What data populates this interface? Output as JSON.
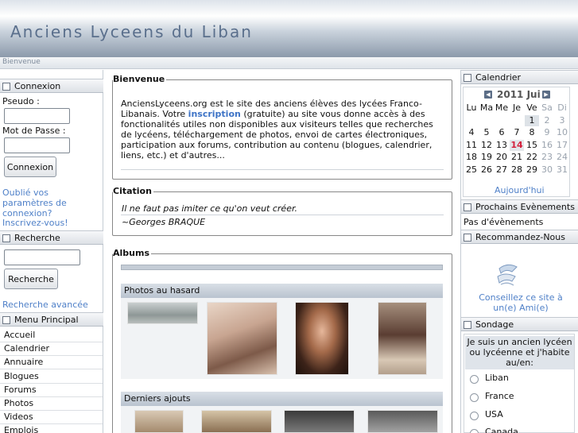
{
  "header": {
    "title": "Anciens Lyceens du Liban",
    "breadcrumb": "Bienvenue"
  },
  "login": {
    "heading": "Connexion",
    "username_label": "Pseudo :",
    "password_label": "Mot de Passe :",
    "submit_label": "Connexion",
    "forgot_link": "Oublié vos paramètres de connexion?",
    "register_link": "Inscrivez-vous!"
  },
  "search": {
    "heading": "Recherche",
    "submit_label": "Recherche",
    "advanced_link": "Recherche avancée"
  },
  "menu": {
    "heading": "Menu Principal",
    "items": [
      "Accueil",
      "Calendrier",
      "Annuaire",
      "Blogues",
      "Forums",
      "Photos",
      "Videos",
      "Emplois"
    ]
  },
  "welcome": {
    "legend": "Bienvenue",
    "text_before": "AnciensLyceens.org est le site des anciens élèves des lycées Franco-Libanais. Votre ",
    "link": "inscription",
    "text_after": " (gratuite) au site vous donne accès à des fonctionalités utiles non disponibles aux visiteurs telles que recherches de lycéens, téléchargement de photos, envoi de cartes électroniques, participation aux forums, contribution au contenu (blogues, calendrier, liens, etc.) et d'autres..."
  },
  "quote": {
    "legend": "Citation",
    "text": "Il ne faut pas imiter ce qu'on veut créer.",
    "author": "~Georges BRAQUE"
  },
  "albums": {
    "legend": "Albums",
    "random_heading": "Photos au hasard",
    "latest_heading": "Derniers ajouts"
  },
  "calendar": {
    "heading": "Calendrier",
    "month_label": "2011 Jui",
    "prev_icon": "prev-arrow-icon",
    "next_icon": "next-arrow-icon",
    "weekdays": [
      "Lu",
      "Ma",
      "Me",
      "Je",
      "Ve",
      "Sa",
      "Di"
    ],
    "weeks": [
      [
        "",
        "",
        "",
        "",
        "1",
        "2",
        "3"
      ],
      [
        "4",
        "5",
        "6",
        "7",
        "8",
        "9",
        "10"
      ],
      [
        "11",
        "12",
        "13",
        "14",
        "15",
        "16",
        "17"
      ],
      [
        "18",
        "19",
        "20",
        "21",
        "22",
        "23",
        "24"
      ],
      [
        "25",
        "26",
        "27",
        "28",
        "29",
        "30",
        "31"
      ]
    ],
    "today_link": "Aujourd'hui"
  },
  "events": {
    "heading": "Prochains Evènements",
    "empty_text": "Pas d'évènements"
  },
  "recommend": {
    "heading": "Recommandez-Nous",
    "link": "Conseillez ce site à un(e) Ami(e)"
  },
  "poll": {
    "heading": "Sondage",
    "question": "Je suis un ancien lycéen ou lycéenne et j'habite au/en:",
    "options": [
      "Liban",
      "France",
      "USA",
      "Canada"
    ]
  },
  "colors": {
    "link": "#4f80c8",
    "today": "#d3203d",
    "accent_bar": "#b9c3cf"
  }
}
